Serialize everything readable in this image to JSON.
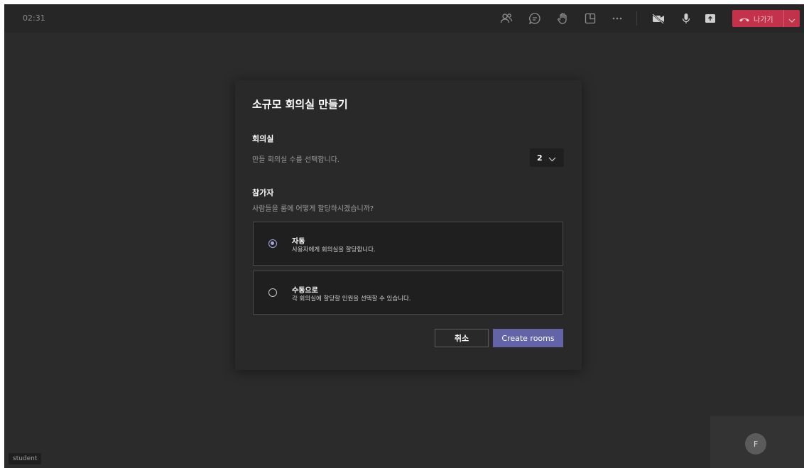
{
  "meeting": {
    "elapsed_time": "02:31"
  },
  "toolbar": {
    "icons": [
      "participants-icon",
      "chat-icon",
      "raise-hand-icon",
      "breakout-rooms-icon",
      "more-options-icon",
      "camera-off-icon",
      "microphone-icon",
      "share-screen-icon"
    ],
    "leave": {
      "label": "나가기",
      "icon": "phone-hangup-icon",
      "color": "#c4314b"
    }
  },
  "dialog": {
    "title": "소규모 회의실 만들기",
    "rooms": {
      "heading": "회의실",
      "description": "만들 회의실 수를 선택합니다.",
      "selected_count": "2"
    },
    "participants": {
      "heading": "참가자",
      "question": "사람들을 룸에 어떻게 할당하시겠습니까?",
      "options": [
        {
          "title": "자동",
          "description": "사용자에게 회의실을 할당합니다.",
          "selected": true
        },
        {
          "title": "수동으로",
          "description": "각 회의실에 할당할 인원을 선택할 수 있습니다.",
          "selected": false
        }
      ]
    },
    "cancel_label": "취소",
    "create_label": "Create rooms",
    "accent_color": "#6264a7"
  },
  "self_video": {
    "initial": "F"
  },
  "participant_name": "student"
}
